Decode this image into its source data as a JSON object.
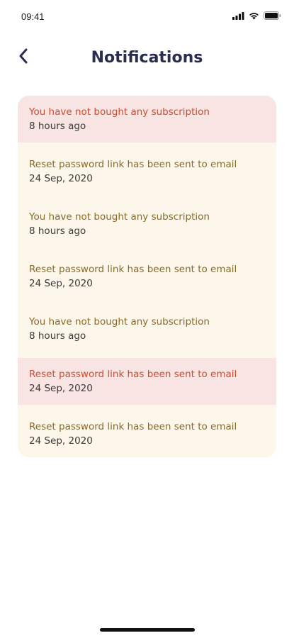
{
  "status_bar": {
    "time": "09:41",
    "icons": [
      "signal-icon",
      "wifi-icon",
      "battery-icon"
    ]
  },
  "header": {
    "title": "Notifications",
    "back_icon": "chevron-left-icon"
  },
  "colors": {
    "title": "#2b2d4f",
    "unread_background": "#f8e4e2",
    "read_background": "#fdf6ea",
    "unread_text": "#d04a2e",
    "read_text": "#8a6a24"
  },
  "notifications": [
    {
      "message": "You have not bought any subscription",
      "time": "8 hours ago",
      "unread": true
    },
    {
      "message": "Reset password link has been sent to email",
      "time": "24 Sep, 2020",
      "unread": false
    },
    {
      "message": "You have not bought any subscription",
      "time": "8 hours ago",
      "unread": false
    },
    {
      "message": "Reset password link has been sent to email",
      "time": "24 Sep, 2020",
      "unread": false
    },
    {
      "message": "You have not bought any subscription",
      "time": "8 hours ago",
      "unread": false
    },
    {
      "message": "Reset password link has been sent to email",
      "time": "24 Sep, 2020",
      "unread": true
    },
    {
      "message": "Reset password link has been sent to email",
      "time": "24 Sep, 2020",
      "unread": false
    }
  ]
}
